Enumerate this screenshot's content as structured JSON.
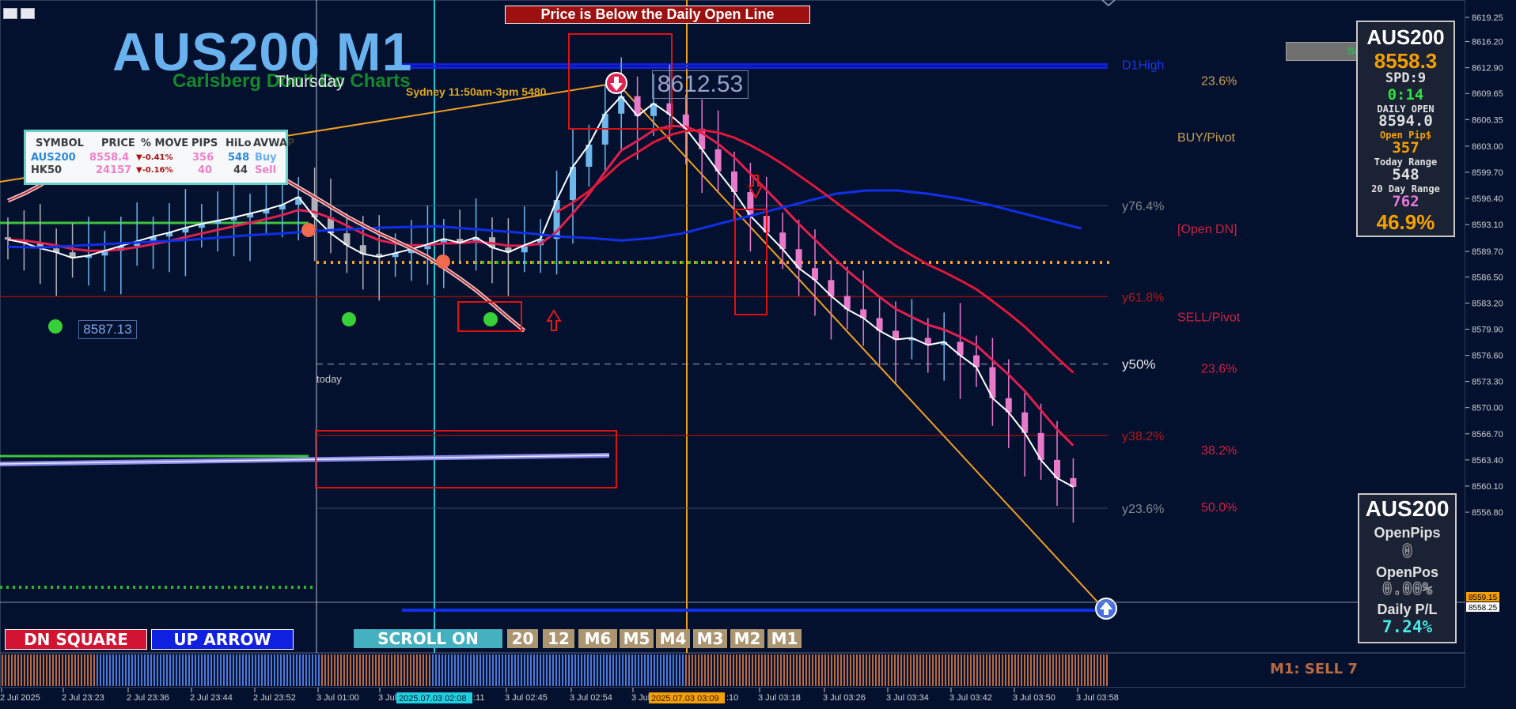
{
  "chart_data": {
    "type": "line",
    "symbol_title": "AUS200 M1",
    "subtitle": "Carlsberg Don't Do Charts",
    "overlay_text": "Thursday",
    "session_label": "Sydney 11:50am-3pm 5480",
    "banner": "Price is Below the Daily Open Line",
    "y_axis_ticks": [
      "8619.25",
      "8616.20",
      "8612.90",
      "8609.65",
      "8606.35",
      "8603.00",
      "8599.70",
      "8596.40",
      "8593.10",
      "8589.70",
      "8586.50",
      "8583.20",
      "8579.90",
      "8576.60",
      "8573.30",
      "8570.00",
      "8566.70",
      "8563.40",
      "8560.10",
      "8556.80"
    ],
    "y_range": [
      8555.3,
      8620.5
    ],
    "price_labels": [
      "8559.15",
      "8558.25"
    ],
    "x_axis_ticks": [
      "2 Jul 2025",
      "2 Jul 23:23",
      "2 Jul 23:36",
      "2 Jul 23:44",
      "2 Jul 23:52",
      "3 Jul 01:00",
      "3 Jul",
      "3 Jul 02:45",
      "3 Jul 02:54",
      "3 Jul",
      "3 Jul 03:18",
      "3 Jul 03:26",
      "3 Jul 03:34",
      "3 Jul 03:42",
      "3 Jul 03:50",
      "3 Jul 03:58"
    ],
    "x_axis_tags": [
      "2025.07.03 02:08",
      "2025.07.03 03:09"
    ],
    "x_tag_fragments": [
      ":11",
      ":10"
    ],
    "close_series": {
      "name": "",
      "values": [
        8591.2,
        8590.8,
        8590.1,
        8589.6,
        8588.9,
        8589.2,
        8589.8,
        8590.4,
        8591.0,
        8591.6,
        8592.1,
        8592.7,
        8593.2,
        8593.6,
        8594.0,
        8594.5,
        8595.0,
        8595.6,
        8596.6,
        8594.0,
        8592.0,
        8590.5,
        8589.4,
        8589.0,
        8589.5,
        8590.0,
        8590.6,
        8591.3,
        8590.8,
        8591.5,
        8590.2,
        8589.6,
        8590.5,
        8591.3,
        8596.2,
        8600.4,
        8603.2,
        8607.1,
        8609.3,
        8606.8,
        8608.4,
        8607.0,
        8605.2,
        8602.6,
        8599.8,
        8597.2,
        8594.2,
        8592.1,
        8590.0,
        8587.6,
        8586.1,
        8584.1,
        8582.4,
        8581.3,
        8579.7,
        8578.6,
        8578.8,
        8577.9,
        8578.3,
        8576.6,
        8575.1,
        8571.2,
        8569.4,
        8566.8,
        8563.4,
        8561.1,
        8560.0
      ]
    },
    "vwap_series": {
      "name": "",
      "values": [
        8590.3,
        8590.2,
        8590.4,
        8590.6,
        8590.8,
        8591.0,
        8591.2,
        8591.5,
        8591.8,
        8592.0,
        8592.3,
        8592.5,
        8592.7,
        8592.8,
        8592.9,
        8592.6,
        8592.3,
        8592.0,
        8591.6,
        8591.4,
        8591.1,
        8591.4,
        8592.0,
        8593.0,
        8594.0,
        8595.0,
        8596.0,
        8597.0,
        8597.4,
        8597.4,
        8597.0,
        8596.4,
        8595.6,
        8594.6,
        8593.6,
        8592.6
      ]
    },
    "levels": [
      {
        "label": "D1High",
        "value": 8613.3
      },
      {
        "label": "23.6%",
        "value": 8611.3
      },
      {
        "label": "BUY/Pivot",
        "value": 8604.2
      },
      {
        "label": "y76.4%",
        "value": 8595.5
      },
      {
        "label": "[Open DN]",
        "value": 8592.6
      },
      {
        "label": "y61.8%",
        "value": 8584.0
      },
      {
        "label": "SELL/Pivot",
        "value": 8581.5
      },
      {
        "label": "y50%",
        "value": 8575.5
      },
      {
        "label": "23.6%",
        "value": 8575.0
      },
      {
        "label": "y38.2%",
        "value": 8566.5
      },
      {
        "label": "38.2%",
        "value": 8564.7
      },
      {
        "label": "y23.6%",
        "value": 8557.3
      },
      {
        "label": "50.0%",
        "value": 8557.5
      }
    ],
    "annotations": [
      {
        "text": "8612.53",
        "value": 8612.53
      },
      {
        "text": "8587.13",
        "value": 8587.13
      },
      {
        "text": "today",
        "value": null
      }
    ],
    "signal_text": "M1: SELL 7"
  },
  "watchlist": {
    "headers": [
      "SYMBOL",
      "PRICE",
      "% MOVE",
      "PIPS",
      "HiLo",
      "AVWAP"
    ],
    "rows": [
      {
        "symbol": "AUS200",
        "price": "8558.4",
        "move": "▼-0.41%",
        "pips": "356",
        "hilo": "548",
        "avwap": "Buy"
      },
      {
        "symbol": "HK50",
        "price": "24157",
        "move": "▼-0.16%",
        "pips": "40",
        "hilo": "44",
        "avwap": "Sell"
      }
    ]
  },
  "info_panel": {
    "symbol": "AUS200",
    "price": "8558.3",
    "spread": "SPD:9",
    "timer": "0:14",
    "daily_open_label": "DAILY OPEN",
    "daily_open": "8594.0",
    "open_pips_label": "Open Pip$",
    "open_pips": "357",
    "today_range_label": "Today Range",
    "today_range": "548",
    "range20_label": "20 Day Range",
    "range20": "762",
    "percent": "46.9%"
  },
  "pl_panel": {
    "symbol": "AUS200",
    "open_pips_label": "OpenPips",
    "open_pips": "0",
    "open_pos_label": "OpenPos",
    "open_pos": "0.00%",
    "daily_pl_label": "Daily P/L",
    "daily_pl": "7.24%"
  },
  "buttons": {
    "dn_square": "DN SQUARE",
    "up_arrow": "UP ARROW",
    "scroll_on": "SCROLL ON",
    "tf": [
      "20",
      "12",
      "M6",
      "M5",
      "M4",
      "M3",
      "M2",
      "M1"
    ]
  },
  "side_button": "Se",
  "colors": {
    "background": "#03112f",
    "bull": "#6fb6ea",
    "bear": "#e878c8",
    "accent_red": "#cc1a1a",
    "orange": "#f0a020"
  }
}
